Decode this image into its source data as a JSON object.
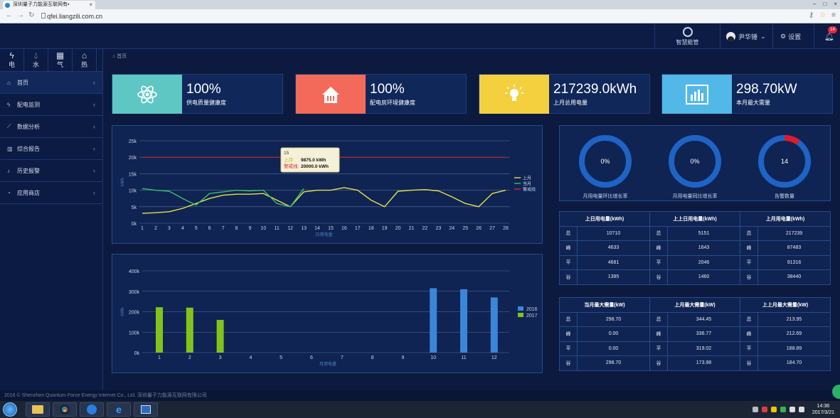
{
  "browser": {
    "tab_title": "深圳量子力能源互联网有▪",
    "tab_close": "×",
    "url": "qfei.liangzili.com.cn",
    "win_controls": [
      "–",
      "□",
      "×"
    ]
  },
  "header": {
    "brand": "智慧能管",
    "user_name": "尹华锤",
    "user_caret": "⌄",
    "settings_label": "设置",
    "notification_count": "14"
  },
  "sidebar": {
    "energy_tabs": [
      {
        "label": "电",
        "icon": "lightning-icon"
      },
      {
        "label": "水",
        "icon": "water-drop-icon"
      },
      {
        "label": "气",
        "icon": "gas-icon"
      },
      {
        "label": "热",
        "icon": "heat-icon"
      }
    ],
    "menu": [
      {
        "label": "首页",
        "icon": "home-icon",
        "active": true
      },
      {
        "label": "配电监测",
        "icon": "bolt-icon"
      },
      {
        "label": "数据分析",
        "icon": "chart-line-icon"
      },
      {
        "label": "综合报告",
        "icon": "report-icon"
      },
      {
        "label": "历史报警",
        "icon": "bell-icon"
      },
      {
        "label": "应用商店",
        "icon": "store-icon"
      }
    ],
    "menu_arrow": "‹"
  },
  "breadcrumb": {
    "label": "首页"
  },
  "kpis": [
    {
      "value": "100%",
      "label": "供电质量健康度",
      "color": "#5ec7c4",
      "icon": "atom-icon"
    },
    {
      "value": "100%",
      "label": "配电房环境健康度",
      "color": "#f36a5a",
      "icon": "factory-house-icon"
    },
    {
      "value": "217239.0kWh",
      "label": "上月总用电量",
      "color": "#f4d03f",
      "icon": "lightbulb-icon"
    },
    {
      "value": "298.70kW",
      "label": "本月最大需量",
      "color": "#52b8e8",
      "icon": "bar-chart-icon"
    }
  ],
  "gauges": [
    {
      "value": "0%",
      "fraction": 0,
      "label": "月用电量环比增长率"
    },
    {
      "value": "0%",
      "fraction": 0,
      "label": "月用电量同比增长率"
    },
    {
      "value": "14",
      "fraction": 0.1,
      "label": "告警数量"
    }
  ],
  "daily_table": {
    "headers": [
      "上日用电量(kWh)",
      "上上日用电量(kWh)",
      "上月用电量(kWh)"
    ],
    "labels": [
      "总",
      "峰",
      "平",
      "谷"
    ],
    "rows": [
      [
        "10710",
        "5151",
        "217239"
      ],
      [
        "4633",
        "1643",
        "87483"
      ],
      [
        "4681",
        "2046",
        "91316"
      ],
      [
        "1395",
        "1460",
        "38440"
      ]
    ]
  },
  "demand_table": {
    "headers": [
      "当月最大需量(kW)",
      "上月最大需量(kW)",
      "上上月最大需量(kW)"
    ],
    "labels": [
      "总",
      "峰",
      "平",
      "谷"
    ],
    "rows": [
      [
        "298.70",
        "344.45",
        "213.95"
      ],
      [
        "0.00",
        "336.77",
        "212.69"
      ],
      [
        "0.00",
        "319.02",
        "188.89"
      ],
      [
        "298.70",
        "173.98",
        "184.70"
      ]
    ]
  },
  "chart_data": [
    {
      "type": "line",
      "xlabel": "日用电量",
      "ylabel": "kWh",
      "ylim": [
        0,
        25000
      ],
      "yticks": [
        "0k",
        "5k",
        "10k",
        "15k",
        "20k",
        "25k"
      ],
      "x": [
        1,
        2,
        3,
        4,
        5,
        6,
        7,
        8,
        9,
        10,
        11,
        12,
        13,
        14,
        15,
        16,
        17,
        18,
        19,
        20,
        21,
        22,
        23,
        24,
        25,
        26,
        27,
        28
      ],
      "series": [
        {
          "name": "上月",
          "color": "#e8e04a",
          "values": [
            3000,
            3200,
            3500,
            4500,
            6000,
            7500,
            8500,
            8800,
            8800,
            9000,
            7000,
            5000,
            9500,
            10000,
            10000,
            10800,
            10000,
            7000,
            5000,
            9700,
            10000,
            10200,
            9800,
            8000,
            6000,
            5000,
            9000,
            10000
          ]
        },
        {
          "name": "当月",
          "color": "#3bbf6a",
          "values": [
            10500,
            10000,
            9700,
            7500,
            5500,
            9000,
            9500,
            10000,
            9800,
            10000,
            6000,
            5000,
            10500,
            null,
            null,
            null,
            null,
            null,
            null,
            null,
            null,
            null,
            null,
            null,
            null,
            null,
            null,
            null
          ]
        },
        {
          "name": "警戒线",
          "color": "#d8282e",
          "values": [
            20000,
            20000,
            20000,
            20000,
            20000,
            20000,
            20000,
            20000,
            20000,
            20000,
            20000,
            20000,
            20000,
            20000,
            20000,
            20000,
            20000,
            20000,
            20000,
            20000,
            20000,
            20000,
            20000,
            20000,
            20000,
            20000,
            20000,
            20000
          ]
        }
      ],
      "tooltip": {
        "title": "15",
        "rows": [
          {
            "label": "上月:",
            "value": "9875.0 kWh"
          },
          {
            "label": "警戒线:",
            "value": "20000.0 kWh"
          }
        ]
      }
    },
    {
      "type": "bar",
      "xlabel": "月用电量",
      "ylabel": "kWh",
      "ylim": [
        0,
        400000
      ],
      "yticks": [
        "0k",
        "100k",
        "200k",
        "300k",
        "400k"
      ],
      "categories": [
        "1",
        "2",
        "3",
        "4",
        "5",
        "6",
        "7",
        "8",
        "9",
        "10",
        "11",
        "12"
      ],
      "series": [
        {
          "name": "2016",
          "color": "#3a86d8",
          "values": [
            0,
            0,
            0,
            0,
            0,
            0,
            0,
            0,
            0,
            315000,
            310000,
            270000
          ]
        },
        {
          "name": "2017",
          "color": "#82c21c",
          "values": [
            222000,
            220000,
            160000,
            0,
            0,
            0,
            0,
            0,
            0,
            0,
            0,
            0
          ]
        }
      ]
    }
  ],
  "footer": {
    "text": "2016 © Shenzhen Quantum Force Energy Internet Co., Ltd. 深圳量子力能源互联网有限公司"
  },
  "taskbar": {
    "time": "14:36",
    "date": "2017/3/21"
  }
}
